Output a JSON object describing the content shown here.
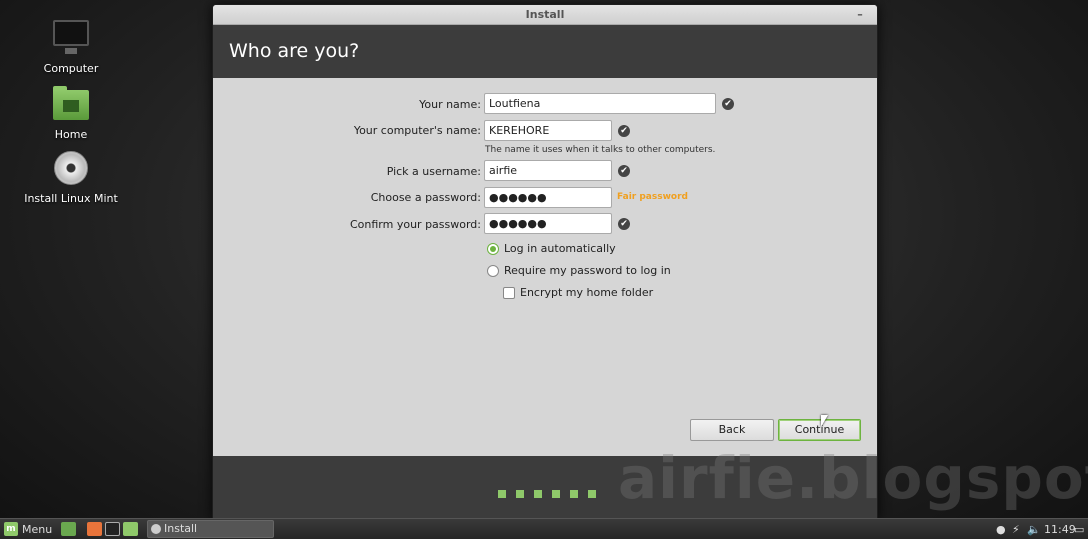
{
  "desktop": {
    "icons": [
      {
        "label": "Computer"
      },
      {
        "label": "Home"
      },
      {
        "label": "Install Linux Mint"
      }
    ]
  },
  "window": {
    "title": "Install",
    "minimize_glyph": "–",
    "header": "Who are you?",
    "form": {
      "name_label": "Your name:",
      "name_value": "Loutfiena",
      "computer_label": "Your computer's name:",
      "computer_value": "KEREHORE",
      "computer_hint": "The name it uses when it talks to other computers.",
      "username_label": "Pick a username:",
      "username_value": "airfie",
      "password_label": "Choose a password:",
      "password_value": "●●●●●●",
      "password_strength": "Fair password",
      "confirm_label": "Confirm your password:",
      "confirm_value": "●●●●●●",
      "check_glyph": "✔",
      "login_auto": "Log in automatically",
      "login_password": "Require my password to log in",
      "encrypt": "Encrypt my home folder"
    },
    "buttons": {
      "back": "Back",
      "continue": "Continue"
    },
    "progress_steps": 6
  },
  "watermark": "airfie.blogspot.co.id",
  "taskbar": {
    "menu_label": "Menu",
    "task_label": "Install",
    "clock": "11:49"
  }
}
